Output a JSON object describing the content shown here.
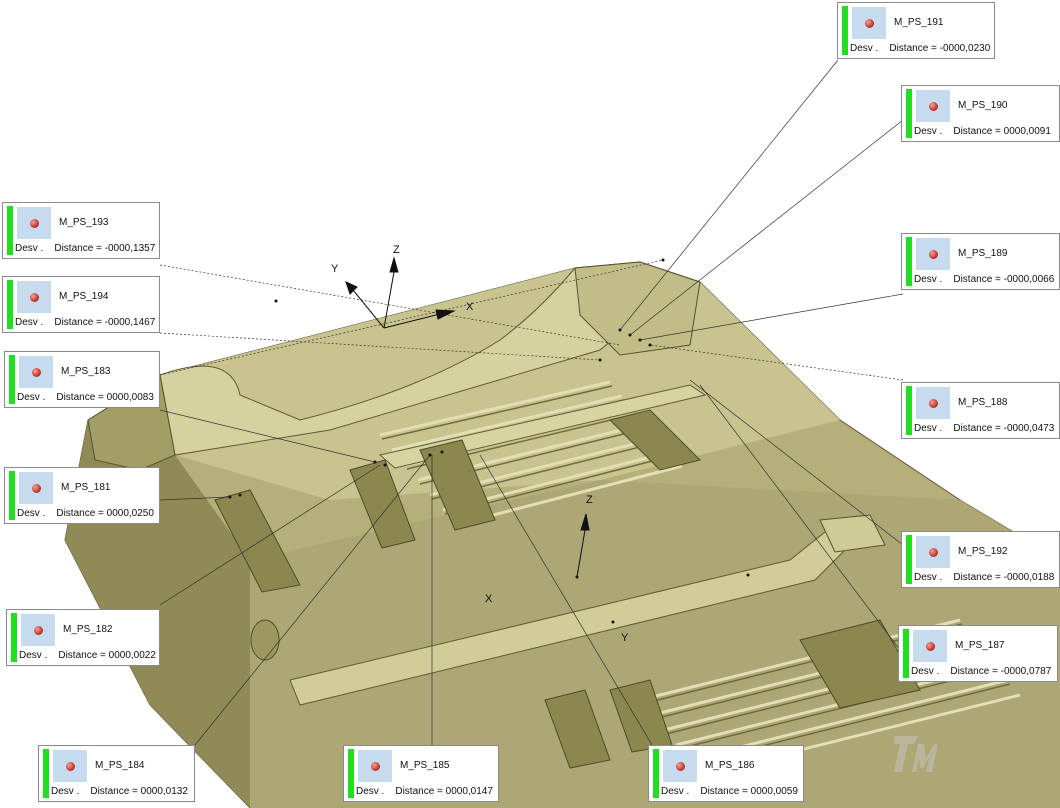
{
  "labels": [
    {
      "id": "M_PS_191",
      "name": "M_PS_191",
      "desv": "Desv .",
      "dist_label": "Distance =",
      "distance": "-0000,0230"
    },
    {
      "id": "M_PS_190",
      "name": "M_PS_190",
      "desv": "Desv .",
      "dist_label": "Distance =",
      "distance": "0000,0091"
    },
    {
      "id": "M_PS_193",
      "name": "M_PS_193",
      "desv": "Desv .",
      "dist_label": "Distance =",
      "distance": "-0000,1357"
    },
    {
      "id": "M_PS_189",
      "name": "M_PS_189",
      "desv": "Desv .",
      "dist_label": "Distance =",
      "distance": "-0000,0066"
    },
    {
      "id": "M_PS_194",
      "name": "M_PS_194",
      "desv": "Desv .",
      "dist_label": "Distance =",
      "distance": "-0000,1467"
    },
    {
      "id": "M_PS_183",
      "name": "M_PS_183",
      "desv": "Desv .",
      "dist_label": "Distance =",
      "distance": "0000,0083"
    },
    {
      "id": "M_PS_188",
      "name": "M_PS_188",
      "desv": "Desv .",
      "dist_label": "Distance =",
      "distance": "-0000,0473"
    },
    {
      "id": "M_PS_181",
      "name": "M_PS_181",
      "desv": "Desv .",
      "dist_label": "Distance =",
      "distance": "0000,0250"
    },
    {
      "id": "M_PS_192",
      "name": "M_PS_192",
      "desv": "Desv .",
      "dist_label": "Distance =",
      "distance": "-0000,0188"
    },
    {
      "id": "M_PS_182",
      "name": "M_PS_182",
      "desv": "Desv .",
      "dist_label": "Distance =",
      "distance": "0000,0022"
    },
    {
      "id": "M_PS_187",
      "name": "M_PS_187",
      "desv": "Desv .",
      "dist_label": "Distance =",
      "distance": "-0000,0787"
    },
    {
      "id": "M_PS_184",
      "name": "M_PS_184",
      "desv": "Desv .",
      "dist_label": "Distance =",
      "distance": "0000,0132"
    },
    {
      "id": "M_PS_185",
      "name": "M_PS_185",
      "desv": "Desv .",
      "dist_label": "Distance =",
      "distance": "0000,0147"
    },
    {
      "id": "M_PS_186",
      "name": "M_PS_186",
      "desv": "Desv .",
      "dist_label": "Distance =",
      "distance": "0000,0059"
    }
  ],
  "axes": {
    "top": {
      "x": "X",
      "y": "Y",
      "z": "Z"
    },
    "center": {
      "x": "X",
      "y": "Y",
      "z": "Z"
    }
  },
  "colors": {
    "status_ok": "#1fe01f",
    "part_surface": "#b5b07a"
  },
  "icons": {
    "label_point": "point-sphere-icon",
    "watermark": "tm-logo-icon"
  }
}
